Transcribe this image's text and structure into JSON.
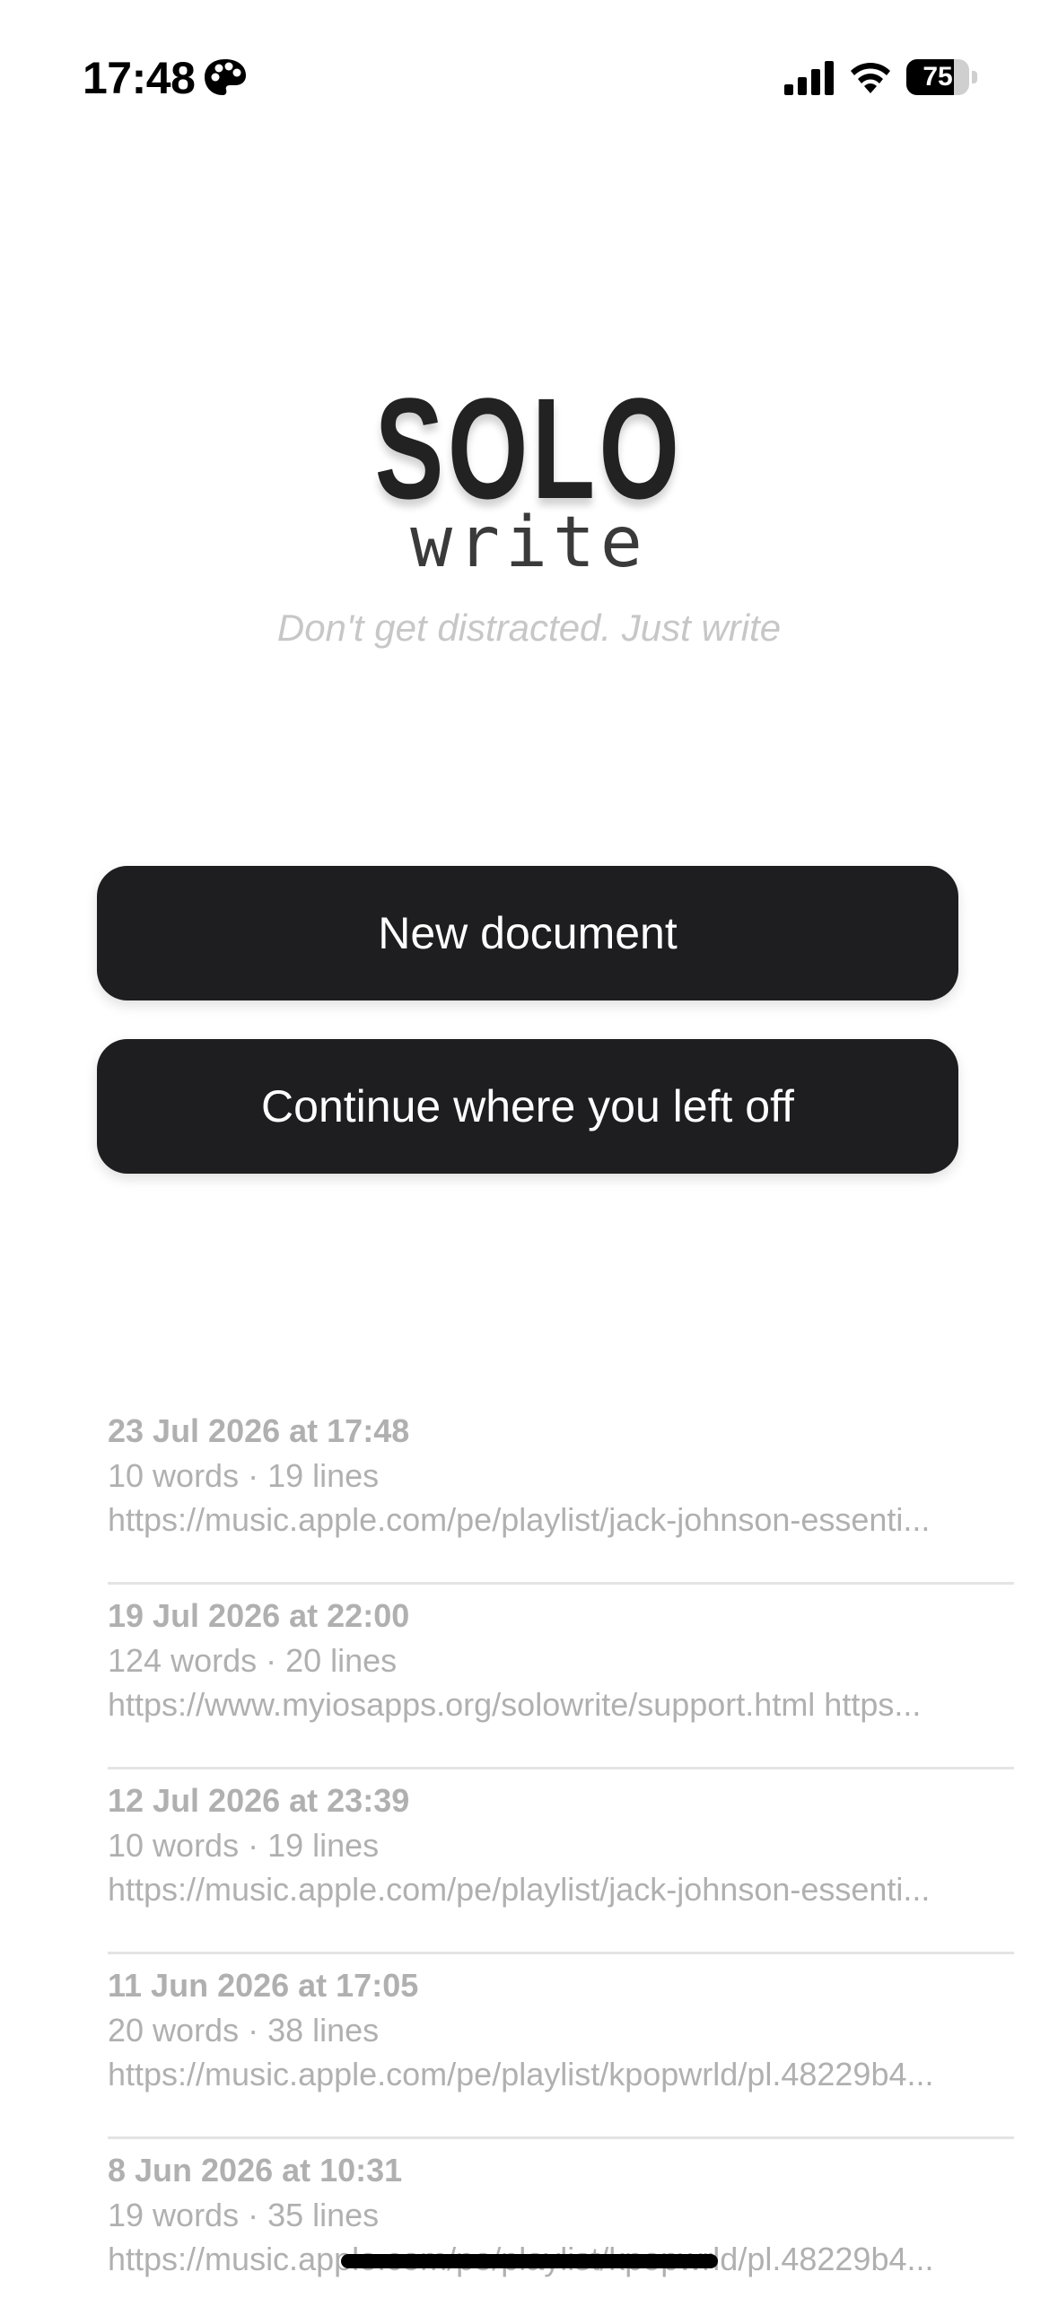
{
  "status_bar": {
    "time": "17:48",
    "battery_level": 75,
    "battery_text": "75",
    "icons": [
      "palette-icon",
      "cellular-signal-icon",
      "wifi-icon",
      "battery-icon"
    ]
  },
  "app": {
    "logo_title": "SOLO",
    "logo_subtitle": "write",
    "tagline": "Don't get distracted. Just write"
  },
  "actions": {
    "new_document": "New document",
    "continue": "Continue where you left off"
  },
  "documents": [
    {
      "date": "23 Jul 2026 at 17:48",
      "stats": "10 words · 19 lines",
      "preview": "https://music.apple.com/pe/playlist/jack-johnson-essenti..."
    },
    {
      "date": "19 Jul 2026 at 22:00",
      "stats": "124 words · 20 lines",
      "preview": "https://www.myiosapps.org/solowrite/support.html  https..."
    },
    {
      "date": "12 Jul 2026 at 23:39",
      "stats": "10 words · 19 lines",
      "preview": "https://music.apple.com/pe/playlist/jack-johnson-essenti..."
    },
    {
      "date": "11 Jun 2026 at 17:05",
      "stats": "20 words · 38 lines",
      "preview": "https://music.apple.com/pe/playlist/kpopwrld/pl.48229b4..."
    },
    {
      "date": "8 Jun 2026 at 10:31",
      "stats": "19 words · 35 lines",
      "preview": "https://music.apple.com/pe/playlist/kpopwrld/pl.48229b4..."
    }
  ],
  "colors": {
    "button_bg": "#1e1e20",
    "button_text": "#ffffff",
    "muted_text": "#b0b0b0",
    "tagline": "#c7c7c7",
    "divider": "#e4e4e4"
  }
}
